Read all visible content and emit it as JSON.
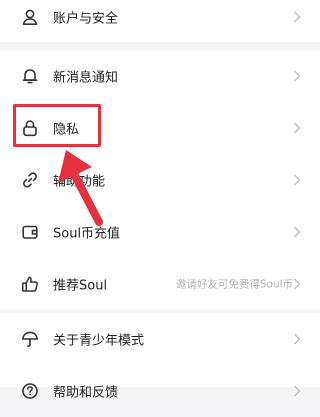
{
  "settings": {
    "items": [
      {
        "id": "account-security",
        "label": "账户与安全",
        "icon": "person-icon",
        "hint": ""
      },
      {
        "id": "notifications",
        "label": "新消息通知",
        "icon": "bell-icon",
        "hint": ""
      },
      {
        "id": "privacy",
        "label": "隐私",
        "icon": "lock-icon",
        "hint": ""
      },
      {
        "id": "accessibility",
        "label": "辅助功能",
        "icon": "link-icon",
        "hint": ""
      },
      {
        "id": "soul-coin-topup",
        "label": "Soul币充值",
        "icon": "wallet-icon",
        "hint": ""
      },
      {
        "id": "recommend-soul",
        "label": "推荐Soul",
        "icon": "thumbs-up-icon",
        "hint": "邀请好友可免费得Soul币"
      },
      {
        "id": "teen-mode",
        "label": "关于青少年模式",
        "icon": "umbrella-icon",
        "hint": ""
      },
      {
        "id": "help-feedback",
        "label": "帮助和反馈",
        "icon": "question-icon",
        "hint": ""
      }
    ]
  },
  "annotation": {
    "highlight_color": "#e5303d",
    "target_item": "privacy"
  }
}
